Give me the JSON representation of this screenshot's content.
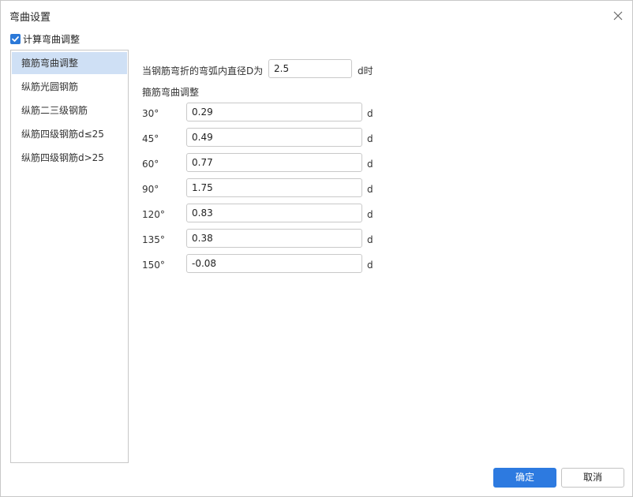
{
  "dialog": {
    "title": "弯曲设置",
    "calc_checkbox": {
      "label": "计算弯曲调整",
      "checked": true
    },
    "sidebar": {
      "items": [
        {
          "label": "箍筋弯曲调整",
          "selected": true
        },
        {
          "label": "纵筋光圆钢筋",
          "selected": false
        },
        {
          "label": "纵筋二三级钢筋",
          "selected": false
        },
        {
          "label": "纵筋四级钢筋d≤25",
          "selected": false
        },
        {
          "label": "纵筋四级钢筋d>25",
          "selected": false
        }
      ]
    },
    "main": {
      "diameter_label": "当钢筋弯折的弯弧内直径D为",
      "diameter_value": "2.5",
      "diameter_unit": "d时",
      "section_title": "箍筋弯曲调整",
      "rows": [
        {
          "angle": "30°",
          "value": "0.29",
          "unit": "d"
        },
        {
          "angle": "45°",
          "value": "0.49",
          "unit": "d"
        },
        {
          "angle": "60°",
          "value": "0.77",
          "unit": "d"
        },
        {
          "angle": "90°",
          "value": "1.75",
          "unit": "d"
        },
        {
          "angle": "120°",
          "value": "0.83",
          "unit": "d"
        },
        {
          "angle": "135°",
          "value": "0.38",
          "unit": "d"
        },
        {
          "angle": "150°",
          "value": "-0.08",
          "unit": "d"
        }
      ]
    },
    "buttons": {
      "ok": "确定",
      "cancel": "取消"
    },
    "colors": {
      "primary": "#2d7ae0",
      "selected_bg": "#cfe0f5",
      "checkbox": "#2b79d8"
    }
  }
}
